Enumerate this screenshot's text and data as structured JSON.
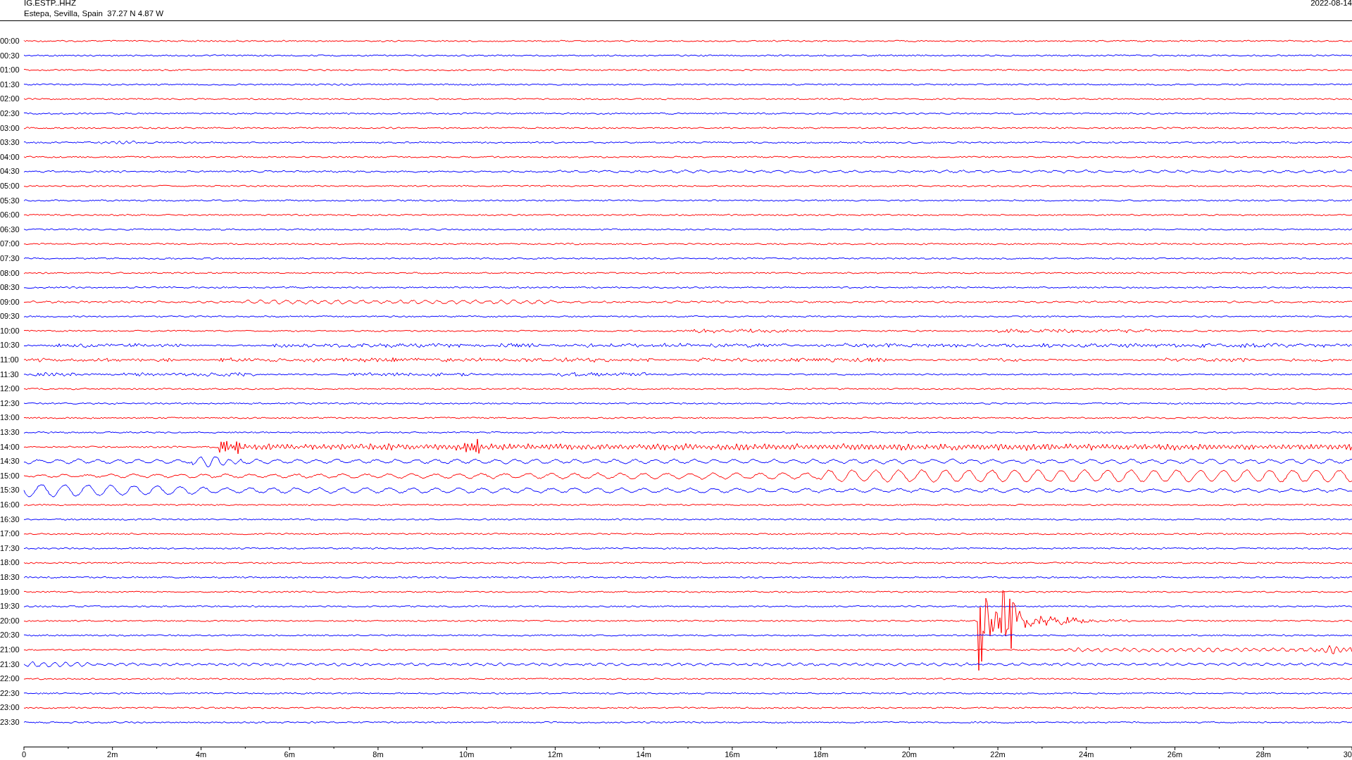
{
  "header": {
    "station": "IG.ESTP..HHZ",
    "location": "Estepa, Sevilla, Spain  37.27 N 4.87 W",
    "date": "2022-08-14"
  },
  "traces": [
    {
      "time": "00:00",
      "color": "#ff0000"
    },
    {
      "time": "00:30",
      "color": "#0000ff"
    },
    {
      "time": "01:00",
      "color": "#ff0000"
    },
    {
      "time": "01:30",
      "color": "#0000ff"
    },
    {
      "time": "02:00",
      "color": "#ff0000"
    },
    {
      "time": "02:30",
      "color": "#0000ff"
    },
    {
      "time": "03:00",
      "color": "#ff0000"
    },
    {
      "time": "03:30",
      "color": "#0000ff"
    },
    {
      "time": "04:00",
      "color": "#ff0000"
    },
    {
      "time": "04:30",
      "color": "#0000ff"
    },
    {
      "time": "05:00",
      "color": "#ff0000"
    },
    {
      "time": "05:30",
      "color": "#0000ff"
    },
    {
      "time": "06:00",
      "color": "#ff0000"
    },
    {
      "time": "06:30",
      "color": "#0000ff"
    },
    {
      "time": "07:00",
      "color": "#ff0000"
    },
    {
      "time": "07:30",
      "color": "#0000ff"
    },
    {
      "time": "08:00",
      "color": "#ff0000"
    },
    {
      "time": "08:30",
      "color": "#0000ff"
    },
    {
      "time": "09:00",
      "color": "#ff0000"
    },
    {
      "time": "09:30",
      "color": "#0000ff"
    },
    {
      "time": "10:00",
      "color": "#ff0000"
    },
    {
      "time": "10:30",
      "color": "#0000ff"
    },
    {
      "time": "11:00",
      "color": "#ff0000"
    },
    {
      "time": "11:30",
      "color": "#0000ff"
    },
    {
      "time": "12:00",
      "color": "#ff0000"
    },
    {
      "time": "12:30",
      "color": "#0000ff"
    },
    {
      "time": "13:00",
      "color": "#ff0000"
    },
    {
      "time": "13:30",
      "color": "#0000ff"
    },
    {
      "time": "14:00",
      "color": "#ff0000"
    },
    {
      "time": "14:30",
      "color": "#0000ff"
    },
    {
      "time": "15:00",
      "color": "#ff0000"
    },
    {
      "time": "15:30",
      "color": "#0000ff"
    },
    {
      "time": "16:00",
      "color": "#ff0000"
    },
    {
      "time": "16:30",
      "color": "#0000ff"
    },
    {
      "time": "17:00",
      "color": "#ff0000"
    },
    {
      "time": "17:30",
      "color": "#0000ff"
    },
    {
      "time": "18:00",
      "color": "#ff0000"
    },
    {
      "time": "18:30",
      "color": "#0000ff"
    },
    {
      "time": "19:00",
      "color": "#ff0000"
    },
    {
      "time": "19:30",
      "color": "#0000ff"
    },
    {
      "time": "20:00",
      "color": "#ff0000"
    },
    {
      "time": "20:30",
      "color": "#0000ff"
    },
    {
      "time": "21:00",
      "color": "#ff0000"
    },
    {
      "time": "21:30",
      "color": "#0000ff"
    },
    {
      "time": "22:00",
      "color": "#ff0000"
    },
    {
      "time": "22:30",
      "color": "#0000ff"
    },
    {
      "time": "23:00",
      "color": "#ff0000"
    },
    {
      "time": "23:30",
      "color": "#0000ff"
    }
  ],
  "x_axis": {
    "tick_labels": [
      "0",
      "2m",
      "4m",
      "6m",
      "8m",
      "10m",
      "12m",
      "14m",
      "16m",
      "18m",
      "20m",
      "22m",
      "24m",
      "26m",
      "28m",
      "30"
    ]
  }
}
